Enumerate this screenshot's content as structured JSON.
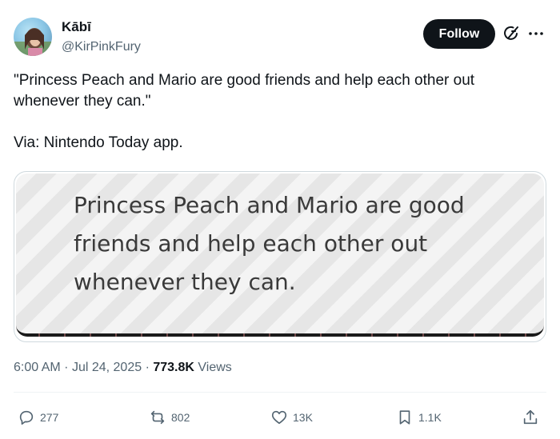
{
  "author": {
    "display_name": "Kābī",
    "handle": "@KirPinkFury"
  },
  "header": {
    "follow_label": "Follow",
    "grok_icon": "grok-icon",
    "more_icon": "more-icon"
  },
  "tweet": {
    "line1": "\"Princess Peach and Mario are good friends and help each other out whenever they can.\"",
    "line2": "Via: Nintendo Today app."
  },
  "media": {
    "caption_text": "Princess Peach and Mario are good friends and help each other out whenever they can."
  },
  "meta": {
    "time": "6:00 AM",
    "separator": "·",
    "date": "Jul 24, 2025",
    "views_count": "773.8K",
    "views_label": "Views"
  },
  "actions": {
    "replies": "277",
    "reposts": "802",
    "likes": "13K",
    "bookmarks": "1.1K",
    "icons": [
      "reply-icon",
      "repost-icon",
      "like-icon",
      "bookmark-icon",
      "share-icon"
    ]
  },
  "colors": {
    "text_primary": "#0f1419",
    "text_secondary": "#536471",
    "follow_bg": "#0f1419",
    "border": "#cfd9de"
  }
}
